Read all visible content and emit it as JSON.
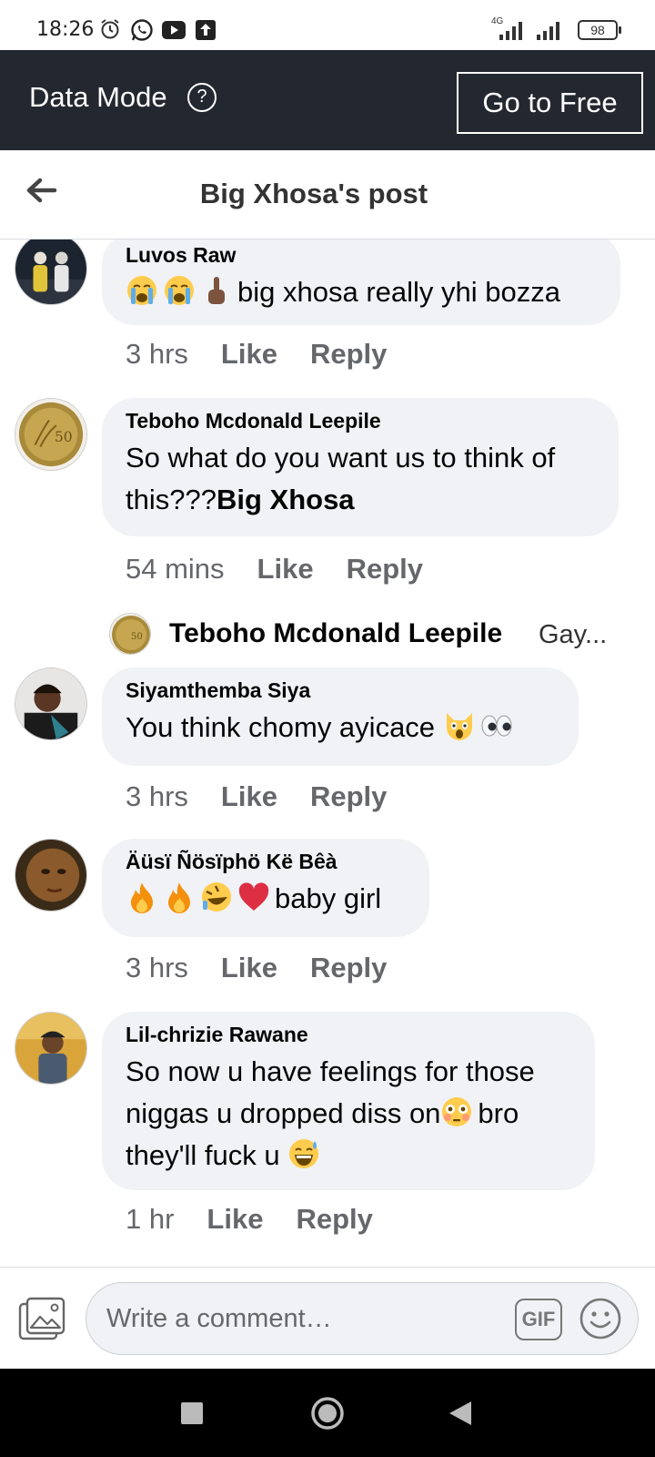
{
  "status_bar": {
    "time": "18:26",
    "battery": "98",
    "network": "4G",
    "icons": [
      "alarm-icon",
      "whatsapp-icon",
      "youtube-icon",
      "upload-icon",
      "signal-icon",
      "signal-icon",
      "battery-icon"
    ]
  },
  "banner": {
    "label": "Data Mode",
    "help_icon": "help-circle-icon",
    "button": "Go to Free"
  },
  "header": {
    "title": "Big Xhosa's post",
    "back_icon": "back-arrow-icon"
  },
  "comments": [
    {
      "author": "Luvos Raw",
      "emojis": [
        "crying-face-emoji",
        "crying-face-emoji",
        "middle-finger-emoji"
      ],
      "text": "big xhosa really yhi bozza",
      "time": "3 hrs",
      "like": "Like",
      "reply": "Reply"
    },
    {
      "author": "Teboho Mcdonald Leepile",
      "text_line1": "So what do you want us to think of",
      "text_line2_prefix": "this???",
      "text_line2_bold": "Big Xhosa",
      "time": "54 mins",
      "like": "Like",
      "reply": "Reply",
      "reply_preview": {
        "author": "Teboho Mcdonald Leepile",
        "text": "Gay..."
      }
    },
    {
      "author": "Siyamthemba Siya",
      "text": "You think chomy ayicace",
      "emojis": [
        "weary-cat-emoji",
        "eyes-emoji"
      ],
      "time": "3 hrs",
      "like": "Like",
      "reply": "Reply"
    },
    {
      "author": "Äüsï Ñösïphö Kë Bêà",
      "emojis": [
        "fire-emoji",
        "fire-emoji",
        "rolling-laughing-emoji",
        "red-heart-emoji"
      ],
      "text": "baby girl",
      "time": "3 hrs",
      "like": "Like",
      "reply": "Reply"
    },
    {
      "author": "Lil-chrizie Rawane",
      "text_line1": "So now u have feelings for those",
      "text_line2a": "niggas u dropped diss on",
      "text_line2b": "bro",
      "text_line3": "they'll fuck u",
      "emojis": [
        "flushed-face-emoji",
        "grinning-sweat-emoji"
      ],
      "time": "1 hr",
      "like": "Like",
      "reply": "Reply"
    }
  ],
  "composer": {
    "placeholder": "Write a comment…",
    "gif_label": "GIF",
    "photo_icon": "photo-icon",
    "emoji_icon": "smiley-icon"
  },
  "nav": [
    "recents-square-icon",
    "home-circle-icon",
    "back-triangle-icon"
  ]
}
